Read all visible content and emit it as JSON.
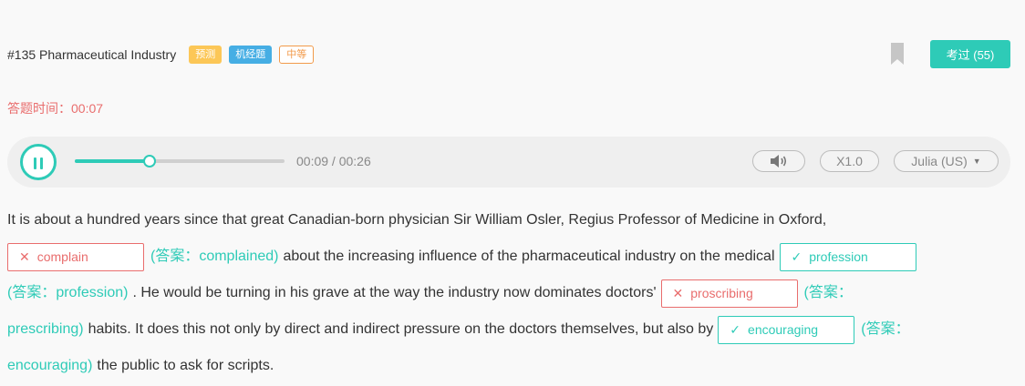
{
  "question": {
    "title": "#135 Pharmaceutical Industry",
    "tags": [
      "预测",
      "机经题",
      "中等"
    ],
    "done_label": "考过 (55)"
  },
  "timer": {
    "label": "答题时间：",
    "value": "00:07"
  },
  "player": {
    "progress": 0.35,
    "time_text": "00:09 / 00:26",
    "speed": "X1.0",
    "voice": "Julia (US)"
  },
  "passage": {
    "line1": "It is about a hundred years since that great Canadian-born physician Sir William Osler, Regius Professor of Medicine in Oxford,",
    "blank1_mark": "✕",
    "blank1_input": "complain",
    "answer1": "(答案：complained)",
    "line2_text": "about the increasing influence of the pharmaceutical industry on the medical",
    "blank2_mark": "✓",
    "blank2_input": "profession",
    "answer2": "(答案：profession)",
    "line3_text": ". He would be turning in his grave at the way the industry now dominates doctors'",
    "blank3_mark": "✕",
    "blank3_input": "proscribing",
    "answer3_a": "(答案：",
    "answer3_b": "prescribing)",
    "line4_text": "habits. It does this not only by direct and indirect pressure on the doctors themselves, but also by",
    "blank4_mark": "✓",
    "blank4_input": "encouraging",
    "answer4_a": "(答案：",
    "answer4_b": "encouraging)",
    "line5_text": "the public to ask for scripts."
  },
  "colors": {
    "accent": "#2ecbb7",
    "error": "#e96d6d",
    "tag_yellow": "#fcc757",
    "tag_blue": "#46aee4",
    "tag_orange": "#f29a4a"
  },
  "icons": {
    "bookmark": "bookmark-icon",
    "play": "pause-icon",
    "volume": "volume-icon",
    "dropdown": "caret-down-icon"
  }
}
